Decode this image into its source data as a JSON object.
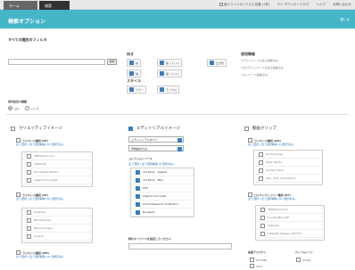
{
  "topbar": {
    "tabs": [
      {
        "label": "ホーム"
      },
      {
        "label": "検索"
      }
    ],
    "links": [
      "個人ライトボックスと収集 (1件)",
      "マイ ダウンロードログ",
      "ヘルプ",
      "お問い合わせ"
    ]
  },
  "header": {
    "title": "検索オプション",
    "close_link": "閉じる"
  },
  "filters": {
    "all_filter_title": "すべての種別のフィルタ",
    "search_button": "検索",
    "orientation_label": "向き",
    "orientations": [
      {
        "label": "横",
        "checked": true
      },
      {
        "label": "縦（トリミ",
        "checked": true
      },
      {
        "label": "正方形",
        "checked": true
      },
      {
        "label": "縦",
        "checked": true
      },
      {
        "label": "縦（トリミ",
        "checked": true
      }
    ],
    "style_label": "スタイル",
    "styles": [
      {
        "label": "カラー",
        "checked": true
      },
      {
        "label": "モノクロ",
        "checked": true
      }
    ],
    "release_label": "使用情報",
    "release_lines": [
      "モデルリリースのある画像のみ",
      "プロパティリリースのある画像のみ",
      "フルリリース画像のみ"
    ],
    "safe_label": "保存設定の調整",
    "safe_radios": [
      {
        "label": "はい",
        "selected": true
      },
      {
        "label": "いいえ",
        "selected": false
      }
    ]
  },
  "col_creative": {
    "title": "クリエイティブイメージ",
    "section1_title": "ライセンス種別 (RF)",
    "section1_links": "全て選択 | 全て選択解除 (33 選択済み)",
    "section1_items": [
      "3DMedical.com",
      "49STOCK",
      "All Canada Photos",
      "Allsport Concepts"
    ],
    "section2_title": "ライセンス種別 (RF)",
    "section2_links": "全て選択 | 全て選択解除 (41 選択済み)",
    "section2_items": [
      "Artworks",
      "Brokerhouse",
      "Blend Images",
      "Cuisine"
    ],
    "section3_title": "ライセンス種別 (RM)",
    "section3_links": "全て選択 | 全て選択解除 (41 選択済み)"
  },
  "col_editorial": {
    "title": "エディトリアルイメージ",
    "select1_value": "エディトリアルすべて",
    "select2_value": "学術論文のみ",
    "collections_title": "コレクションソース",
    "collections_links": "全て選択 | 全て選択解除 (8 選択済み)",
    "collection_items": [
      "3rd Party - Agents",
      "3rd Party - Misc",
      "AFP",
      "Allsport Concepts",
      "Arnold Newman Collection",
      "Bongarts"
    ],
    "phrase_label": "除外キーワードを指定してください"
  },
  "col_video": {
    "title": "動画クリップ",
    "section1_title": "ライセンス種別 (RM)",
    "section1_links": "全て選択 | 全て選択解除 (9 選択済み)",
    "section1_items": [
      "Art Shooting",
      "Open Minds",
      "Andrew Films",
      "dick_clark productions"
    ],
    "section2_title": "ロイヤリティフリー種別 (RF)",
    "section2_links": "全て選択 | 全て選択解除 (41 選択済み)",
    "section2_items": [
      "3DMedical.com",
      "A Lump Blue DP",
      "Artbeats",
      "Artbeatz Images / RF Film"
    ],
    "aspect_label": "画面アスペクト",
    "aspect_opts": [
      "4:3 (SD)",
      "16:9"
    ],
    "fps_label": "フレームレート",
    "fps_opts": [
      "24 fps"
    ]
  },
  "colors": {
    "header": "#45b5c8",
    "accent": "#3c7dc4"
  }
}
